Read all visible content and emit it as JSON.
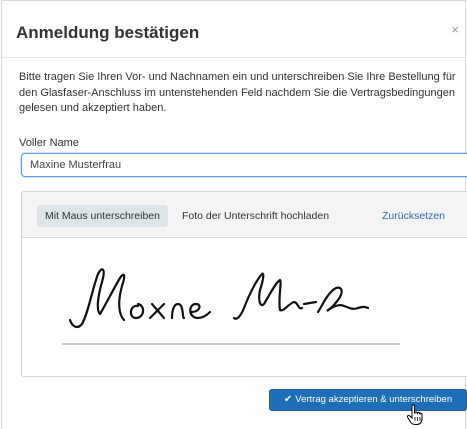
{
  "modal": {
    "title": "Anmeldung bestätigen",
    "close_label": "×",
    "intro_text": "Bitte tragen Sie Ihren Vor- und Nachnamen ein und unterschreiben Sie Ihre Bestellung für den Glasfaser-Anschluss im untenstehenden Feld nachdem Sie die Vertragsbedingungen gelesen und akzeptiert haben."
  },
  "name_field": {
    "label": "Voller Name",
    "value": "Maxine Musterfrau"
  },
  "signature": {
    "tabs": {
      "draw_label": "Mit Maus unterschreiben",
      "upload_label": "Foto der Unterschrift hochladen",
      "reset_label": "Zurücksetzen"
    }
  },
  "submit": {
    "label": "Vertrag akzeptieren & unterschreiben",
    "icon": "check-icon"
  },
  "colors": {
    "primary": "#1e6fb8",
    "link": "#2a6fb5",
    "active_tab": "#dde5e9",
    "input_focus": "#5aa0e8"
  }
}
